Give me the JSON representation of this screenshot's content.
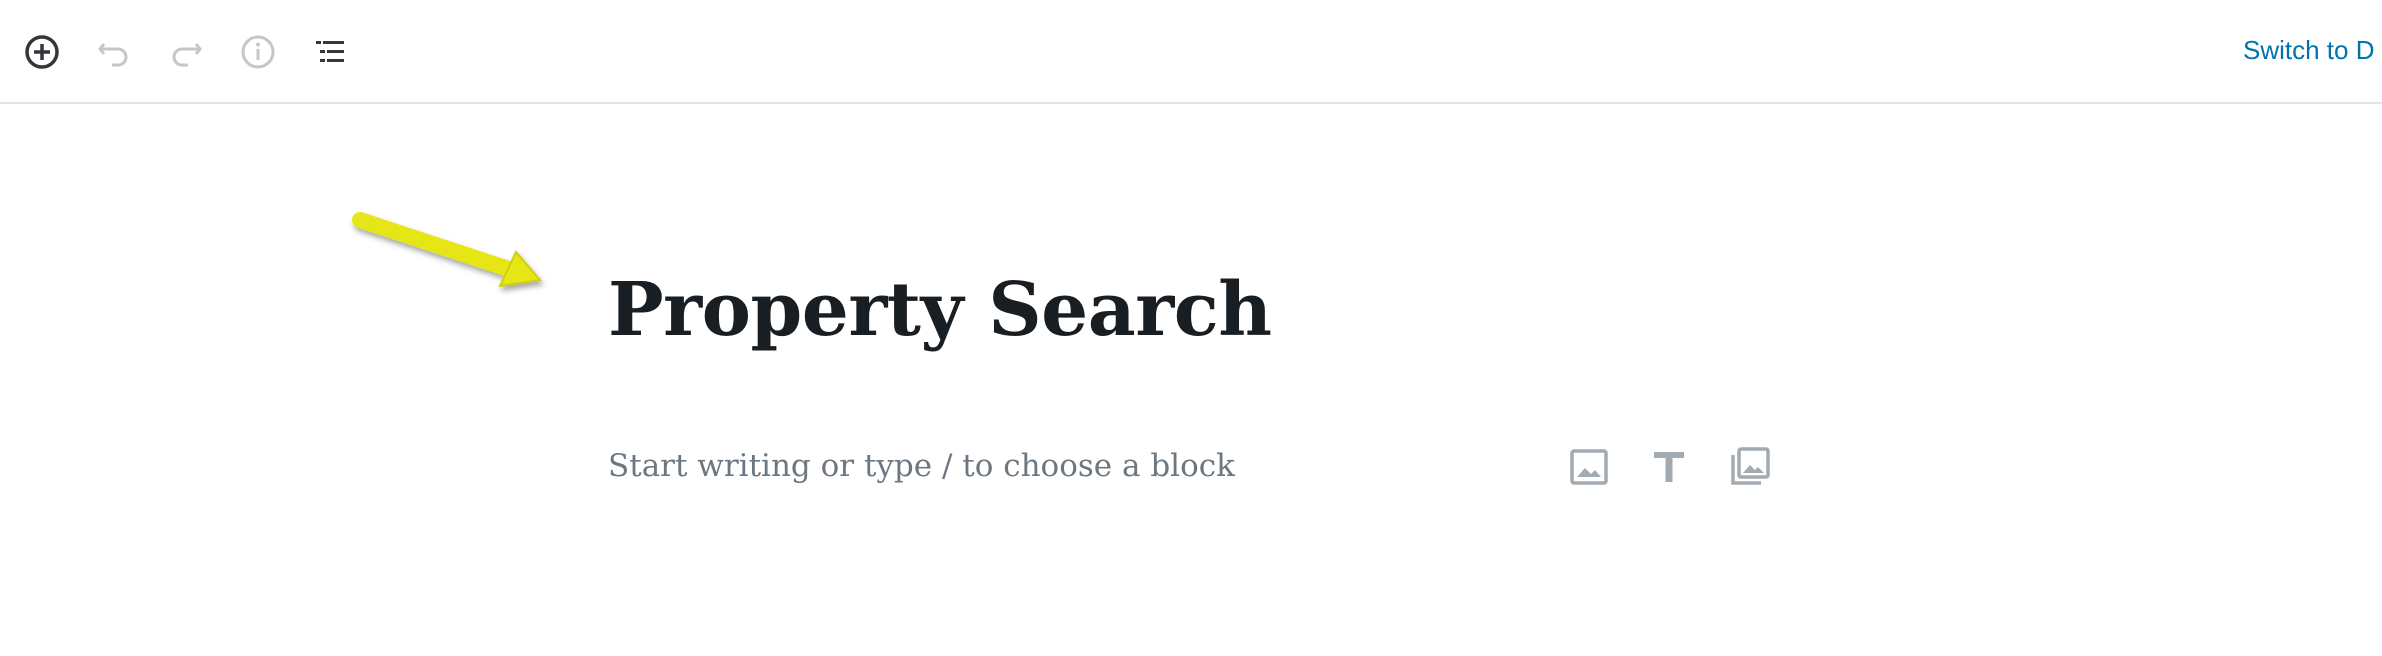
{
  "toolbar": {
    "icons": {
      "add": "plus-circle-icon",
      "undo": "undo-icon",
      "redo": "redo-icon",
      "info": "info-icon",
      "outline": "list-outline-icon"
    },
    "switch_label": "Switch to D"
  },
  "annotation": {
    "icon": "yellow-arrow",
    "color": "#e6e619"
  },
  "editor": {
    "title": "Property Search",
    "appender_placeholder": "Start writing or type / to choose a block",
    "inserter_icons": [
      "image-icon",
      "heading-icon",
      "gallery-icon"
    ]
  },
  "colors": {
    "link": "#0073aa",
    "icon_dark": "#555d66",
    "icon_disabled": "#c3c7cb",
    "icon_block": "#a2aab2",
    "title": "#191e23",
    "placeholder": "#6c7781"
  }
}
